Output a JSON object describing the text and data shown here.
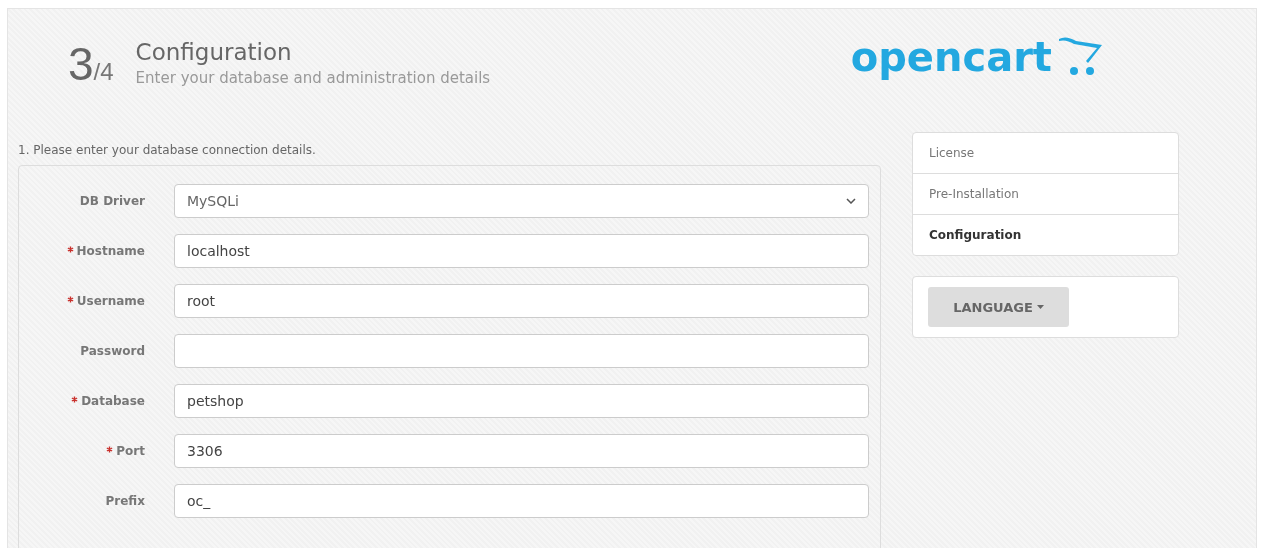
{
  "header": {
    "step": "3",
    "step_total": "/4",
    "title": "Configuration",
    "subtitle": "Enter your database and administration details",
    "logo": "opencart"
  },
  "form": {
    "instruction": "1. Please enter your database connection details.",
    "fields": [
      {
        "label": "DB Driver",
        "kind": "select",
        "required": false,
        "value": "MySQLi"
      },
      {
        "label": "Hostname",
        "kind": "text",
        "required": true,
        "value": "localhost"
      },
      {
        "label": "Username",
        "kind": "text",
        "required": true,
        "value": "root"
      },
      {
        "label": "Password",
        "kind": "text",
        "required": false
      },
      {
        "label": "Database",
        "kind": "text",
        "required": true,
        "value": "petshop"
      },
      {
        "label": "Port",
        "kind": "text",
        "required": true,
        "value": "3306"
      },
      {
        "label": "Prefix",
        "kind": "text",
        "required": false,
        "value": "oc_"
      }
    ]
  },
  "sidebar": {
    "steps": [
      {
        "label": "License",
        "selected": false
      },
      {
        "label": "Pre-Installation",
        "selected": false
      },
      {
        "label": "Configuration",
        "selected": true
      }
    ],
    "language_button": "LANGUAGE"
  }
}
